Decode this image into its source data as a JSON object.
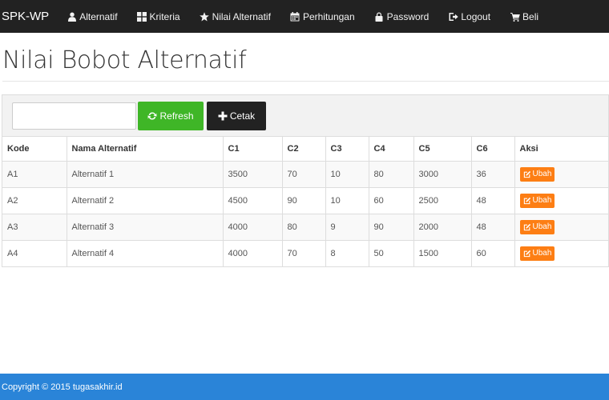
{
  "nav": {
    "brand": "SPK-WP",
    "items": [
      {
        "label": "Alternatif",
        "icon": "user-icon"
      },
      {
        "label": "Kriteria",
        "icon": "th-large-icon"
      },
      {
        "label": "Nilai Alternatif",
        "icon": "star-icon"
      },
      {
        "label": "Perhitungan",
        "icon": "calendar-icon"
      },
      {
        "label": "Password",
        "icon": "lock-icon"
      },
      {
        "label": "Logout",
        "icon": "logout-icon"
      },
      {
        "label": "Beli",
        "icon": "cart-icon"
      }
    ]
  },
  "page": {
    "title": "Nilai Bobot Alternatif"
  },
  "toolbar": {
    "search_value": "",
    "refresh_label": "Refresh",
    "cetak_label": "Cetak"
  },
  "table": {
    "headers": [
      "Kode",
      "Nama Alternatif",
      "C1",
      "C2",
      "C3",
      "C4",
      "C5",
      "C6",
      "Aksi"
    ],
    "rows": [
      {
        "kode": "A1",
        "nama": "Alternatif 1",
        "c1": "3500",
        "c2": "70",
        "c3": "10",
        "c4": "80",
        "c5": "3000",
        "c6": "36",
        "aksi": "Ubah"
      },
      {
        "kode": "A2",
        "nama": "Alternatif 2",
        "c1": "4500",
        "c2": "90",
        "c3": "10",
        "c4": "60",
        "c5": "2500",
        "c6": "48",
        "aksi": "Ubah"
      },
      {
        "kode": "A3",
        "nama": "Alternatif 3",
        "c1": "4000",
        "c2": "80",
        "c3": "9",
        "c4": "90",
        "c5": "2000",
        "c6": "48",
        "aksi": "Ubah"
      },
      {
        "kode": "A4",
        "nama": "Alternatif 4",
        "c1": "4000",
        "c2": "70",
        "c3": "8",
        "c4": "50",
        "c5": "1500",
        "c6": "60",
        "aksi": "Ubah"
      }
    ]
  },
  "footer": {
    "text": "Copyright © 2015 tugasakhir.id"
  },
  "colors": {
    "navbar": "#222222",
    "refresh": "#3fb627",
    "ubah": "#fd7e14",
    "footer": "#2a84d8"
  }
}
